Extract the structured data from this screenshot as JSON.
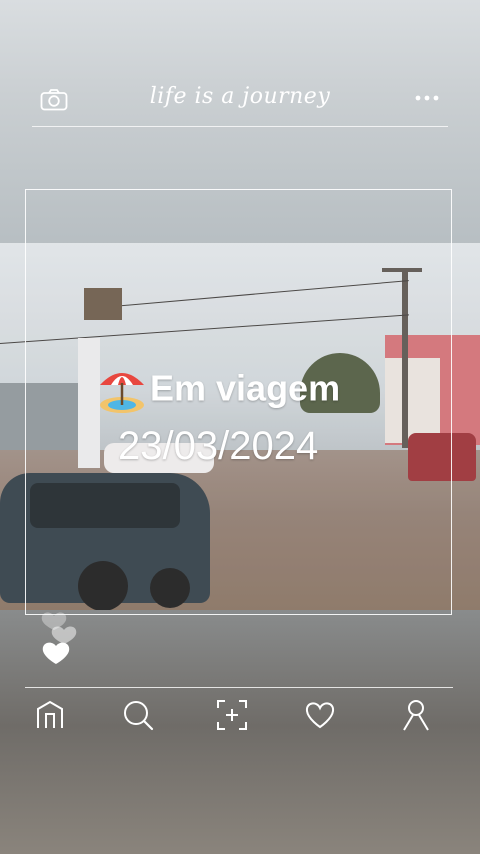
{
  "header": {
    "tagline": "life is a journey",
    "camera_icon": "camera-icon",
    "more_icon": "more-dots-icon"
  },
  "post": {
    "title": "Em viagem",
    "title_emoji": "beach-umbrella-emoji",
    "date": "23/03/2024"
  },
  "reactions": {
    "icon": "stacked-hearts-icon"
  },
  "bottom_nav": [
    {
      "name": "home",
      "icon": "home-icon"
    },
    {
      "name": "search",
      "icon": "search-icon"
    },
    {
      "name": "add",
      "icon": "add-frame-icon"
    },
    {
      "name": "likes",
      "icon": "heart-icon"
    },
    {
      "name": "profile",
      "icon": "profile-icon"
    }
  ],
  "colors": {
    "overlay_text": "#ffffff",
    "pink_building": "#d16e74",
    "car_red": "#9a2e33"
  }
}
